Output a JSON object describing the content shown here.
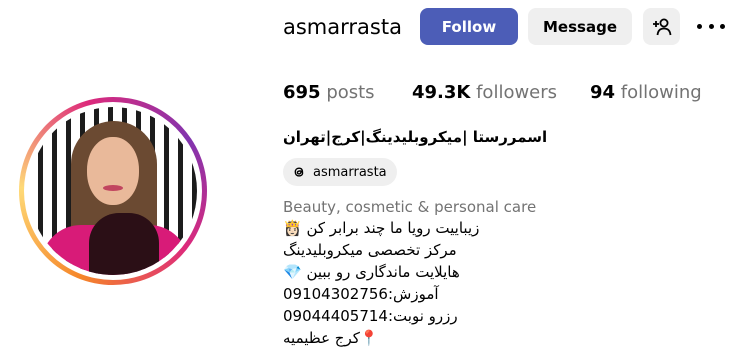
{
  "profile": {
    "username": "asmarrasta",
    "follow_label": "Follow",
    "message_label": "Message",
    "add_user_icon": "add-user-icon",
    "more_icon": "more-options-icon",
    "stats": {
      "posts_count": "695",
      "posts_label": "posts",
      "followers_count": "49.3K",
      "followers_label": "followers",
      "following_count": "94",
      "following_label": "following"
    },
    "full_name": "اسمررستا |میکروبلیدینگ|کرج|تهران",
    "threads_handle": "asmarrasta",
    "category": "Beauty, cosmetic & personal care",
    "bio": [
      "زیباییت رویا ما چند برابر کن 👸🏻",
      "مرکز تخصصی میکروبلیدینگ",
      "هایلایت ماندگاری رو ببین 💎",
      "آموزش:09104302756",
      "رزرو نوبت:09044405714",
      "📍کرج عظیمیه"
    ]
  },
  "colors": {
    "follow_button": "#4c5db7",
    "secondary_button": "#efefef",
    "muted_text": "#737373"
  }
}
